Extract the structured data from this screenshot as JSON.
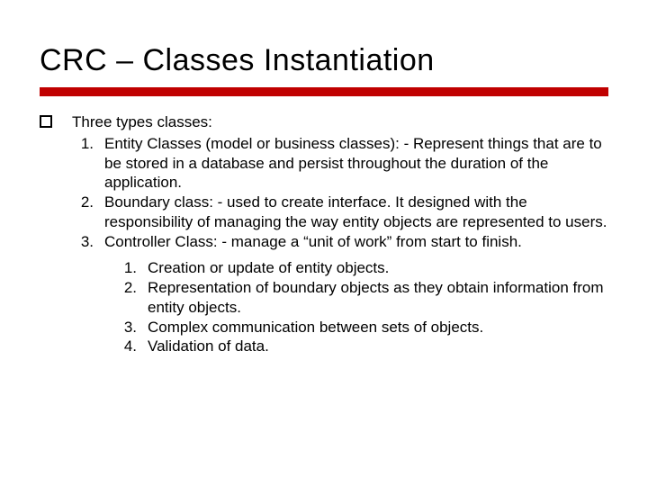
{
  "title": "CRC – Classes Instantiation",
  "lvl1": "Three types classes:",
  "lvl2": [
    {
      "n": "1.",
      "t": "Entity Classes (model or business classes): - Represent things that are to be stored in a database and persist throughout the duration of the application."
    },
    {
      "n": "2.",
      "t": "Boundary class: -  used to create interface. It designed with the responsibility of managing the way entity objects are represented to users."
    },
    {
      "n": "3.",
      "t": "Controller Class: -  manage a “unit of work” from start to finish."
    }
  ],
  "lvl3": [
    {
      "n": "1.",
      "t": "Creation or update of entity objects."
    },
    {
      "n": "2.",
      "t": "Representation of boundary objects as they obtain information from entity objects."
    },
    {
      "n": "3.",
      "t": "Complex communication between sets of objects."
    },
    {
      "n": "4.",
      "t": "Validation of data."
    }
  ]
}
